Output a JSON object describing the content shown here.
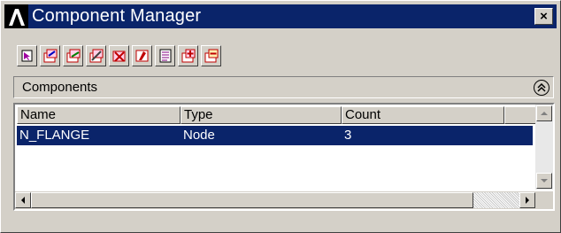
{
  "window": {
    "title": "Component Manager",
    "close_glyph": "×"
  },
  "toolbar": {
    "buttons": [
      {
        "name": "select-entities-button",
        "icon": "select-icon"
      },
      {
        "name": "create-component-button",
        "icon": "create-component-icon"
      },
      {
        "name": "edit-component-button",
        "icon": "edit-component-icon"
      },
      {
        "name": "rename-component-button",
        "icon": "rename-icon"
      },
      {
        "name": "delete-component-button",
        "icon": "delete-icon"
      },
      {
        "name": "plot-component-button",
        "icon": "plot-icon"
      },
      {
        "name": "list-component-button",
        "icon": "list-icon"
      },
      {
        "name": "add-to-component-button",
        "icon": "add-icon"
      },
      {
        "name": "remove-from-component-button",
        "icon": "remove-icon"
      }
    ]
  },
  "components": {
    "header": "Components",
    "columns": [
      "Name",
      "Type",
      "Count"
    ],
    "rows": [
      {
        "name": "N_FLANGE",
        "type": "Node",
        "count": "3",
        "selected": true
      }
    ]
  },
  "colors": {
    "titlebar": "#0a246a",
    "selection": "#0a246a",
    "chrome": "#d4d0c8"
  }
}
